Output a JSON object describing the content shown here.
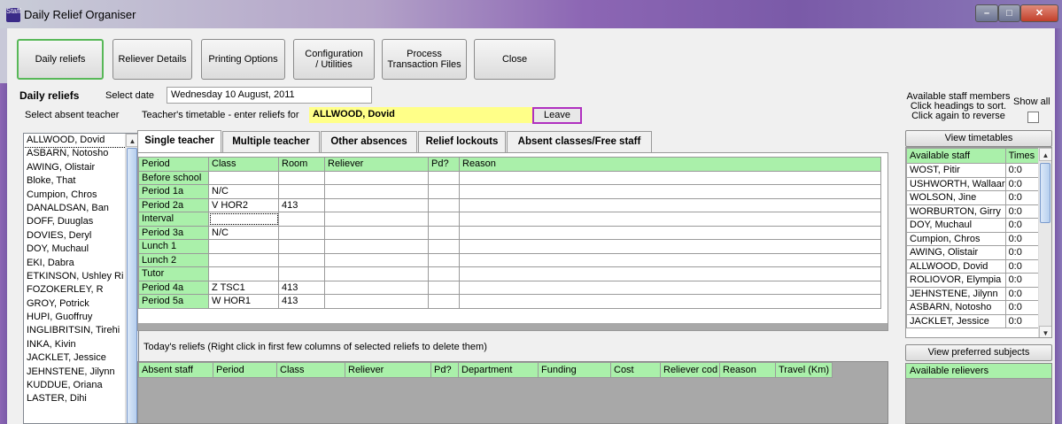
{
  "window": {
    "title": "Daily Relief Organiser",
    "app_icon_text": "Staff"
  },
  "toolbar": {
    "buttons": [
      {
        "label": "Daily reliefs"
      },
      {
        "label": "Reliever Details"
      },
      {
        "label": "Printing Options"
      },
      {
        "label": "Configuration\n/ Utilities"
      },
      {
        "label": "Process\nTransaction Files"
      },
      {
        "label": "Close"
      }
    ]
  },
  "header": {
    "section_title": "Daily reliefs",
    "select_date_label": "Select date",
    "date_value": "Wednesday 10 August, 2011",
    "select_absent_label": "Select absent teacher",
    "timetable_label": "Teacher's timetable - enter reliefs for",
    "teacher_name": "ALLWOOD, Dovid",
    "leave_button": "Leave"
  },
  "absent_list": [
    "ALLWOOD, Dovid",
    "ASBARN, Notosho",
    "AWING, Olistair",
    "Bloke, That",
    "Cumpion, Chros",
    "DANALDSAN, Ban",
    "DOFF, Duuglas",
    "DOVIES, Deryl",
    "DOY, Muchaul",
    "EKI, Dabra",
    "ETKINSON, Ushley Ri",
    "FOZOKERLEY, R",
    "GROY, Potrick",
    "HUPI, Guoffruy",
    "INGLIBRITSIN, Tirehi",
    "INKA, Kivin",
    "JACKLET, Jessice",
    "JEHNSTENE, Jilynn",
    "KUDDUE, Oriana",
    "LASTER, Dihi"
  ],
  "tabs": [
    "Single teacher",
    "Multiple teacher",
    "Other absences",
    "Relief lockouts",
    "Absent classes/Free staff"
  ],
  "timetable": {
    "columns": [
      "Period",
      "Class",
      "Room",
      "Reliever",
      "Pd?",
      "Reason"
    ],
    "rows": [
      {
        "period": "Before school",
        "class": "",
        "room": ""
      },
      {
        "period": "Period 1a",
        "class": "N/C",
        "room": ""
      },
      {
        "period": "Period 2a",
        "class": "V HOR2",
        "room": "413"
      },
      {
        "period": "Interval",
        "class": "",
        "room": ""
      },
      {
        "period": "Period 3a",
        "class": "N/C",
        "room": ""
      },
      {
        "period": "Lunch 1",
        "class": "",
        "room": ""
      },
      {
        "period": "Lunch 2",
        "class": "",
        "room": ""
      },
      {
        "period": "Tutor",
        "class": "",
        "room": ""
      },
      {
        "period": "Period 4a",
        "class": "Z TSC1",
        "room": "413"
      },
      {
        "period": "Period 5a",
        "class": "W HOR1",
        "room": "413"
      }
    ]
  },
  "todays_reliefs": {
    "caption": "Today's reliefs  (Right click in first few columns of selected reliefs to delete them)",
    "columns": [
      "Absent staff",
      "Period",
      "Class",
      "Reliever",
      "Pd?",
      "Department",
      "Funding",
      "Cost",
      "Reliever cod",
      "Reason",
      "Travel (Km)"
    ]
  },
  "right_panel": {
    "available_label": "Available staff members\nClick headings to sort.\nClick again to reverse",
    "show_all_label": "Show all",
    "view_timetables": "View timetables",
    "staff_columns": [
      "Available staff",
      "Times"
    ],
    "staff": [
      {
        "name": "WOST, Pitir",
        "times": "0:0"
      },
      {
        "name": "USHWORTH, Wallaar",
        "times": "0:0"
      },
      {
        "name": "WOLSON, Jine",
        "times": "0:0"
      },
      {
        "name": "WORBURTON, Girry",
        "times": "0:0"
      },
      {
        "name": "DOY, Muchaul",
        "times": "0:0"
      },
      {
        "name": "Cumpion, Chros",
        "times": "0:0"
      },
      {
        "name": "AWING, Olistair",
        "times": "0:0"
      },
      {
        "name": "ALLWOOD, Dovid",
        "times": "0:0"
      },
      {
        "name": "ROLIOVOR, Elympia",
        "times": "0:0"
      },
      {
        "name": "JEHNSTENE, Jilynn",
        "times": "0:0"
      },
      {
        "name": "ASBARN, Notosho",
        "times": "0:0"
      },
      {
        "name": "JACKLET, Jessice",
        "times": "0:0"
      }
    ],
    "view_preferred": "View preferred subjects",
    "available_relievers": "Available relievers"
  }
}
